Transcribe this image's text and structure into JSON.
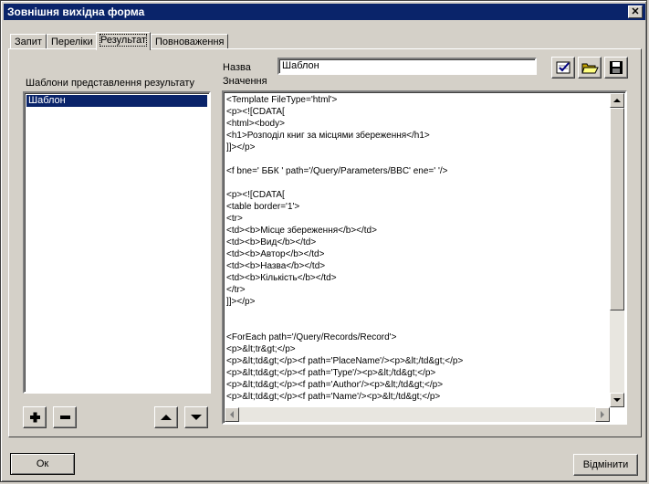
{
  "window": {
    "title": "Зовнішня вихідна форма",
    "close_glyph": "✕"
  },
  "tabs": [
    {
      "label": "Запит"
    },
    {
      "label": "Переліки"
    },
    {
      "label": "Результат",
      "active": true
    },
    {
      "label": "Повноваження"
    }
  ],
  "templates": {
    "label": "Шаблони представлення результату",
    "items": [
      "Шаблон"
    ],
    "selected": "Шаблон"
  },
  "name_field": {
    "label": "Назва",
    "value": "Шаблон"
  },
  "value_field": {
    "label": "Значення",
    "lines": [
      "<Template FileType='html'>",
      "<p><![CDATA[",
      "<html><body>",
      "<h1>Розподіл книг за місцями збереження</h1>",
      "]]></p>",
      "",
      "<f bne=' ББК ' path='/Query/Parameters/BBC' ene=' '/>",
      "",
      "<p><![CDATA[",
      "<table border='1'>",
      "<tr>",
      "<td><b>Місце збереження</b></td>",
      "<td><b>Вид</b></td>",
      "<td><b>Автор</b></td>",
      "<td><b>Назва</b></td>",
      "<td><b>Кількість</b></td>",
      "</tr>",
      "]]></p>",
      "",
      "",
      "<ForEach path='/Query/Records/Record'>",
      "<p>&lt;tr&gt;</p>",
      "<p>&lt;td&gt;</p><f path='PlaceName'/><p>&lt;/td&gt;</p>",
      "<p>&lt;td&gt;</p><f path='Type'/><p>&lt;/td&gt;</p>",
      "<p>&lt;td&gt;</p><f path='Author'/><p>&lt;/td&gt;</p>",
      "<p>&lt;td&gt;</p><f path='Name'/><p>&lt;/td&gt;</p>"
    ]
  },
  "buttons": {
    "ok": "Ок",
    "cancel": "Відмінити"
  },
  "icons": {
    "add": "plus-icon",
    "remove": "minus-icon",
    "up": "arrow-up-icon",
    "down": "arrow-down-icon",
    "check": "check-icon",
    "open": "folder-open-icon",
    "save": "floppy-disk-icon"
  },
  "colors": {
    "title_bg": "#0a246a",
    "face": "#d4d0c8",
    "selection": "#0a246a"
  }
}
